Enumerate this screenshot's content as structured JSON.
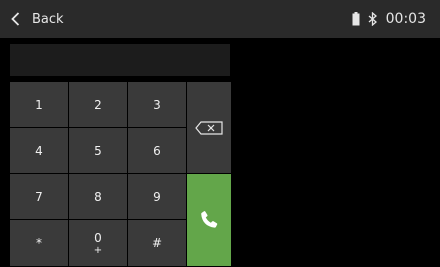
{
  "status_bar": {
    "back_label": "Back",
    "time": "00:03",
    "icons": [
      "back-chevron-icon",
      "battery-icon",
      "bluetooth-icon"
    ]
  },
  "display": {
    "number": ""
  },
  "keypad": {
    "keys": [
      {
        "label": "1",
        "sub": ""
      },
      {
        "label": "2",
        "sub": ""
      },
      {
        "label": "3",
        "sub": ""
      },
      {
        "label": "4",
        "sub": ""
      },
      {
        "label": "5",
        "sub": ""
      },
      {
        "label": "6",
        "sub": ""
      },
      {
        "label": "7",
        "sub": ""
      },
      {
        "label": "8",
        "sub": ""
      },
      {
        "label": "9",
        "sub": ""
      },
      {
        "label": "*",
        "sub": ""
      },
      {
        "label": "0",
        "sub": "+"
      },
      {
        "label": "#",
        "sub": ""
      }
    ],
    "backspace_icon": "backspace-icon",
    "call_icon": "phone-icon"
  },
  "colors": {
    "status_bar_bg": "#2a2a2a",
    "key_bg": "#3a3a3a",
    "call_button": "#63a64a",
    "background": "#000000"
  }
}
